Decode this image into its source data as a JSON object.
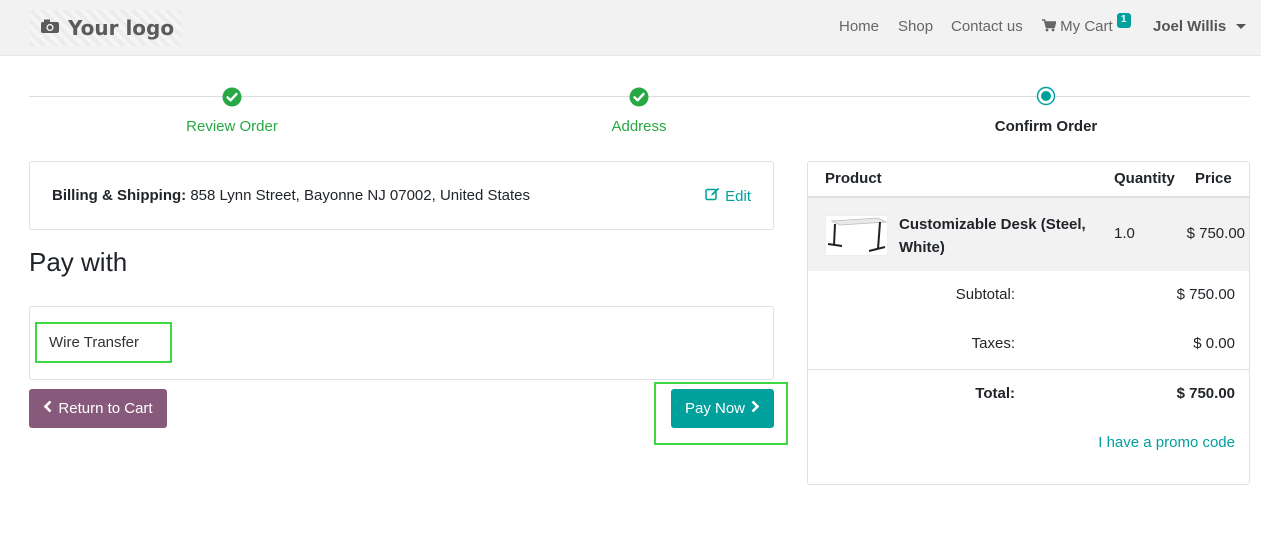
{
  "navbar": {
    "logo_text": "Your logo",
    "links": {
      "home": "Home",
      "shop": "Shop",
      "contact": "Contact us",
      "cart": "My Cart"
    },
    "cart_count": "1",
    "user_name": "Joel Willis"
  },
  "wizard": {
    "steps": [
      {
        "label": "Review Order",
        "state": "done"
      },
      {
        "label": "Address",
        "state": "done"
      },
      {
        "label": "Confirm Order",
        "state": "current"
      }
    ]
  },
  "billing": {
    "label": "Billing & Shipping:",
    "address": "858 Lynn Street, Bayonne NJ 07002, United States",
    "edit_label": "Edit"
  },
  "payment": {
    "heading": "Pay with",
    "option_label": "Wire Transfer",
    "return_label": "Return to Cart",
    "pay_label": "Pay Now"
  },
  "summary": {
    "headers": {
      "product": "Product",
      "quantity": "Quantity",
      "price": "Price"
    },
    "product": {
      "name": "Customizable Desk (Steel, White)",
      "quantity": "1.0",
      "price": "$ 750.00"
    },
    "subtotal_label": "Subtotal:",
    "subtotal_value": "$ 750.00",
    "taxes_label": "Taxes:",
    "taxes_value": "$ 0.00",
    "total_label": "Total:",
    "total_value": "$ 750.00",
    "promo_label": "I have a promo code"
  },
  "colors": {
    "accent": "#00a09d",
    "success": "#28a745",
    "return_button": "#875a7b",
    "highlight": "#40d840"
  }
}
